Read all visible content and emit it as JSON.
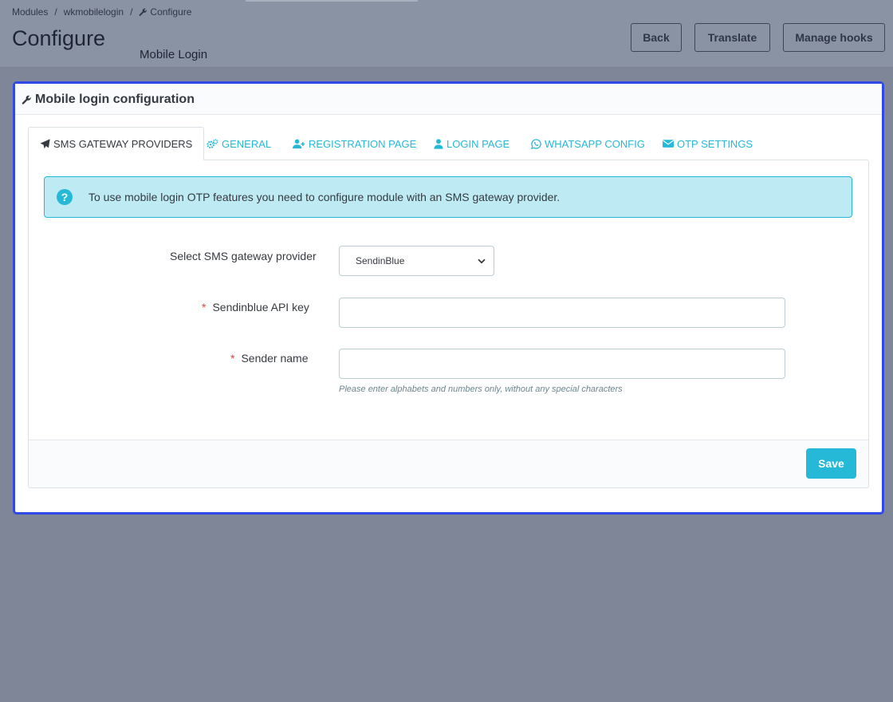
{
  "breadcrumb": {
    "items": [
      "Modules",
      "wkmobilelogin",
      "Configure"
    ],
    "separator": "/"
  },
  "header": {
    "title": "Configure",
    "subtitle": "Mobile Login",
    "buttons": {
      "back": "Back",
      "translate": "Translate",
      "manage_hooks": "Manage hooks"
    }
  },
  "panel": {
    "title": "Mobile login configuration",
    "tabs": [
      {
        "label": "SMS GATEWAY PROVIDERS",
        "icon": "paper-plane-icon",
        "active": true
      },
      {
        "label": "GENERAL",
        "icon": "gears-icon",
        "active": false
      },
      {
        "label": "REGISTRATION PAGE",
        "icon": "user-plus-icon",
        "active": false
      },
      {
        "label": "LOGIN PAGE",
        "icon": "user-icon",
        "active": false
      },
      {
        "label": "WHATSAPP CONFIG",
        "icon": "whatsapp-icon",
        "active": false
      },
      {
        "label": "OTP SETTINGS",
        "icon": "envelope-icon",
        "active": false
      }
    ],
    "alert": {
      "icon": "question-circle-icon",
      "text": "To use mobile login OTP features you need to configure module with an SMS gateway provider."
    },
    "form": {
      "provider_label": "Select SMS gateway provider",
      "provider_value": "SendinBlue",
      "api_key_label": "Sendinblue API key",
      "api_key_value": "",
      "sender_label": "Sender name",
      "sender_value": "",
      "sender_help": "Please enter alphabets and numbers only, without any special characters",
      "required_mark": "*"
    },
    "save_label": "Save"
  },
  "colors": {
    "accent": "#25b9d7",
    "panel_outline": "#2f49e8",
    "required": "#e5413a",
    "overlay": "#7e8698"
  }
}
